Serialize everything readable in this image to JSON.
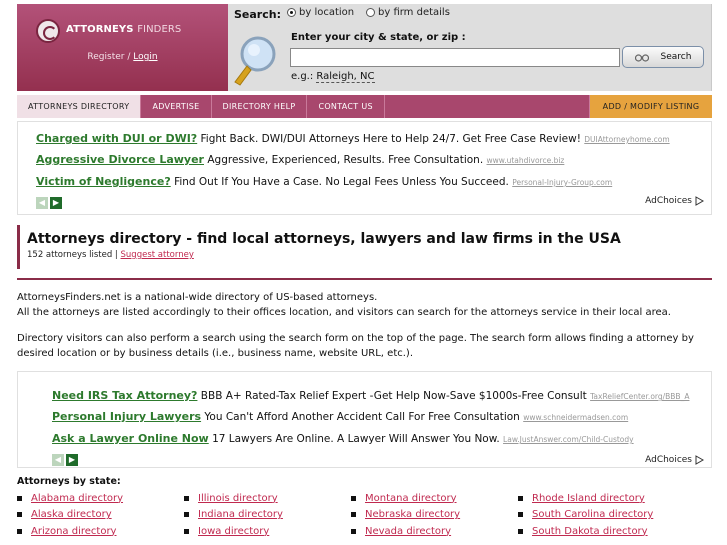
{
  "header": {
    "logo_main": "ATTORNEYS",
    "logo_finders": "FINDERS",
    "register_text": "Register",
    "separator": "/",
    "login_text": "Login"
  },
  "search": {
    "label": "Search:",
    "option_location": "by location",
    "option_firm": "by firm details",
    "selected_option": "by location",
    "enter_label": "Enter your city & state, or zip :",
    "input_value": "",
    "example_prefix": "e.g.:",
    "example_value": "Raleigh, NC",
    "button_label": "Search"
  },
  "nav": {
    "items": [
      {
        "label": "ATTORNEYS DIRECTORY"
      },
      {
        "label": "ADVERTISE"
      },
      {
        "label": "DIRECTORY HELP"
      },
      {
        "label": "CONTACT US"
      }
    ],
    "add_listing": "ADD / MODIFY LISTING"
  },
  "ads_top": {
    "items": [
      {
        "title": "Charged with DUI or DWI?",
        "text": "Fight Back. DWI/DUI Attorneys Here to Help 24/7. Get Free Case Review!",
        "url": "DUIAttorneyhome.com"
      },
      {
        "title": "Aggressive Divorce Lawyer",
        "text": "Aggressive, Experienced, Results. Free Consultation.",
        "url": "www.utahdivorce.biz"
      },
      {
        "title": "Victim of Negligence?",
        "text": "Find Out If You Have a Case. No Legal Fees Unless You Succeed.",
        "url": "Personal-Injury-Group.com"
      }
    ],
    "adchoices": "AdChoices"
  },
  "ads_bottom": {
    "items": [
      {
        "title": "Need IRS Tax Attorney?",
        "text": "BBB A+ Rated-Tax Relief Expert -Get Help Now-Save $1000s-Free Consult",
        "url": "TaxReliefCenter.org/BBB_A"
      },
      {
        "title": "Personal Injury Lawyers",
        "text": "You Can't Afford Another Accident Call For Free Consultation",
        "url": "www.schneidermadsen.com"
      },
      {
        "title": "Ask a Lawyer Online Now",
        "text": "17 Lawyers Are Online. A Lawyer Will Answer You Now.",
        "url": "Law.JustAnswer.com/Child-Custody"
      }
    ],
    "adchoices": "AdChoices"
  },
  "main": {
    "title": "Attorneys directory - find local attorneys, lawyers and law firms in the USA",
    "count_text": "152 attorneys listed |",
    "suggest_link": "Suggest attorney",
    "intro_line1": "AttorneysFinders.net is a national-wide directory of US-based attorneys.",
    "intro_line2": "All the attorneys are listed accordingly to their offices location, and visitors can search for the attorneys service in their local area.",
    "intro_para2": "Directory visitors can also perform a search using the search form on the top of the page. The search form allows finding a attorney by desired location or by business details (i.e., business name, website URL, etc.)."
  },
  "states": {
    "heading": "Attorneys by state:",
    "columns": [
      [
        "Alabama directory",
        "Alaska directory",
        "Arizona directory"
      ],
      [
        "Illinois directory",
        "Indiana directory",
        "Iowa directory"
      ],
      [
        "Montana directory",
        "Nebraska directory",
        "Nevada directory"
      ],
      [
        "Rhode Island directory",
        "South Carolina directory",
        "South Dakota directory"
      ]
    ]
  }
}
